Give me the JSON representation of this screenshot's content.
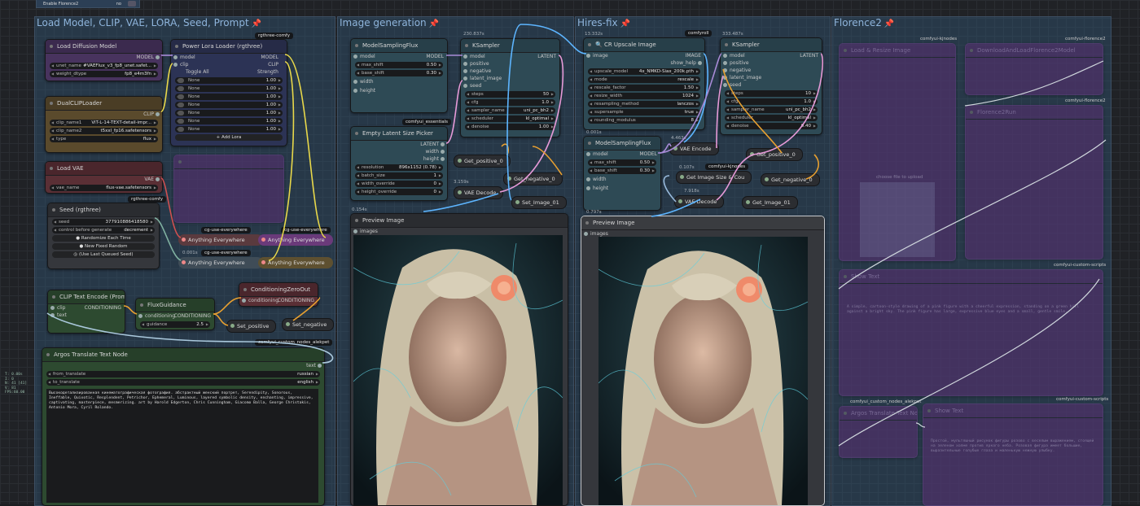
{
  "top_node": {
    "label": "Enable Florence2",
    "value": "no"
  },
  "groups": [
    {
      "title": "Load Model, CLIP, VAE, LORA, Seed, Prompt"
    },
    {
      "title": "Image generation"
    },
    {
      "title": "Hires-fix"
    },
    {
      "title": "Florence2"
    }
  ],
  "pin_icon": "📌",
  "badges": {
    "rgthree1": "rgthree-comfy",
    "rgthree2": "rgthree-comfy",
    "essentials": "comfyui_essentials",
    "comfyroll": "comfyroll",
    "kjnodes": "comfyui-kjnodes",
    "argos": "comfyui_custom_nodes_alekpet",
    "cg1": "cg-use-everywhere",
    "cg2": "cg-use-everywhere",
    "cg3": "cg-use-everywhere"
  },
  "timings": {
    "t1": "230.837s",
    "t2": "13.332s",
    "t3": "333.487s",
    "t4": "0.001s",
    "t5": "4.463s",
    "t6": "0.107s",
    "t7": "7.918s",
    "t8": "0.154s",
    "t9": "0.001s",
    "t10": "0.797s",
    "t11": "3.159s"
  },
  "load_diffusion": {
    "title": "Load Diffusion Model",
    "out": "MODEL",
    "unet_name": "unet_name",
    "unet_val": "#VAEFlux_v3_fp8_unet.safet...",
    "dtype": "weight_dtype",
    "dtype_val": "fp8_e4m3fn"
  },
  "lora": {
    "title": "Power Lora Loader (rgthree)",
    "in_model": "model",
    "in_clip": "clip",
    "out_model": "MODEL",
    "out_clip": "CLIP",
    "toggle": "Toggle All",
    "strength": "Strength",
    "rows": [
      {
        "n": "None",
        "v": "1.00"
      },
      {
        "n": "None",
        "v": "1.00"
      },
      {
        "n": "None",
        "v": "1.00"
      },
      {
        "n": "None",
        "v": "1.00"
      },
      {
        "n": "None",
        "v": "1.00"
      },
      {
        "n": "None",
        "v": "1.00"
      },
      {
        "n": "None",
        "v": "1.00"
      }
    ],
    "add": "+ Add Lora"
  },
  "dualclip": {
    "title": "DualCLIPLoader",
    "out": "CLIP",
    "c1": "clip_name1",
    "c1v": "ViT-L-14-TEXT-detail-impr...",
    "c2": "clip_name2",
    "c2v": "t5xxl_fp16.safetensors",
    "t": "type",
    "tv": "flux"
  },
  "vae": {
    "title": "Load VAE",
    "out": "VAE",
    "n": "vae_name",
    "v": "flux-vae.safetensors"
  },
  "seed": {
    "title": "Seed (rgthree)",
    "seed": "seed",
    "seed_val": "377910886418580",
    "cbg": "control before generate",
    "cbg_val": "decrement",
    "b1": "Randomize Each Time",
    "b2": "New Fixed Random",
    "b3": "(Use Last Queued Seed)"
  },
  "anything": [
    "Anything Everywhere",
    "Anything Everywhere",
    "Anything Everywhere",
    "Anything Everywhere",
    "Anything Everywhere"
  ],
  "clip_encode": {
    "title": "CLIP Text Encode (Prompt)",
    "clip": "clip",
    "text": "text",
    "out": "CONDITIONING"
  },
  "flux_guidance": {
    "title": "FluxGuidance",
    "in": "conditioning",
    "out": "CONDITIONING",
    "g": "guidance",
    "gv": "2.5"
  },
  "cond_zero": {
    "title": "ConditioningZeroOut",
    "in": "conditioning",
    "out": "CONDITIONING"
  },
  "set_positive": "Set_positive",
  "set_negative": "Set_negative",
  "argos": {
    "title": "Argos Translate Text Node",
    "out": "text",
    "from": "from_translate",
    "from_v": "russian",
    "to": "to_translate",
    "to_v": "english",
    "text": "Высокодетализированная кинематографическая фотография. абстрактный женский портрет, Serendipity, Sonorous, Ineffable, Quixotic, Resplendent, Petrichor, Ephemeral, Luminous, layered symbolic density, enchanting, impressive, captivating, masterpiece, mesmerizing. art by Harold Edgerton, Chris Cunningham, Giacomo Balla, George Christakis, Antonio Mora, Cyril Rolando."
  },
  "msf1": {
    "title": "ModelSamplingFlux",
    "in": "model",
    "out": "MODEL",
    "ms": "max_shift",
    "msv": "0.50",
    "bs": "base_shift",
    "bsv": "0.30",
    "w": "width",
    "h": "height"
  },
  "ksampler1": {
    "title": "KSampler",
    "out": "LATENT",
    "ins": [
      "model",
      "positive",
      "negative",
      "latent_image",
      "seed"
    ],
    "w": [
      {
        "k": "steps",
        "v": "50"
      },
      {
        "k": "cfg",
        "v": "1.0"
      },
      {
        "k": "sampler_name",
        "v": "uni_pc_bh2"
      },
      {
        "k": "scheduler",
        "v": "kl_optimal"
      },
      {
        "k": "denoise",
        "v": "1.00"
      }
    ]
  },
  "latent_picker": {
    "title": "Empty Latent Size Picker",
    "outs": [
      "LATENT",
      "width",
      "height"
    ],
    "w": [
      {
        "k": "resolution",
        "v": "896x1152 (0.78)"
      },
      {
        "k": "batch_size",
        "v": "1"
      },
      {
        "k": "width_override",
        "v": "0"
      },
      {
        "k": "height_override",
        "v": "0"
      }
    ]
  },
  "get_pos1": "Get_positive_0",
  "get_neg1": "Get_negative_0",
  "vae_decode1": "VAE Decode",
  "set_image": "Set_Image_01",
  "preview1": {
    "title": "Preview Image",
    "in": "images"
  },
  "upscale": {
    "title": "CR Upscale Image",
    "in": "image",
    "out1": "IMAGE",
    "out2": "show_help",
    "w": [
      {
        "k": "upscale_model",
        "v": "4x_NMKD-Siax_200k.pth"
      },
      {
        "k": "mode",
        "v": "rescale"
      },
      {
        "k": "rescale_factor",
        "v": "1.50"
      },
      {
        "k": "resize_width",
        "v": "1024"
      },
      {
        "k": "resampling_method",
        "v": "lanczos"
      },
      {
        "k": "supersample",
        "v": "true"
      },
      {
        "k": "rounding_modulus",
        "v": "8"
      }
    ]
  },
  "ksampler2": {
    "title": "KSampler",
    "out": "LATENT",
    "ins": [
      "model",
      "positive",
      "negative",
      "latent_image",
      "seed"
    ],
    "w": [
      {
        "k": "steps",
        "v": "10"
      },
      {
        "k": "cfg",
        "v": "1.0"
      },
      {
        "k": "sampler_name",
        "v": "uni_pc_bh2"
      },
      {
        "k": "scheduler",
        "v": "kl_optimal"
      },
      {
        "k": "denoise",
        "v": "0.40"
      }
    ]
  },
  "msf2": {
    "title": "ModelSamplingFlux",
    "in": "model",
    "out": "MODEL",
    "ms": "max_shift",
    "msv": "0.50",
    "bs": "base_shift",
    "bsv": "0.30",
    "w": "width",
    "h": "height"
  },
  "vae_encode": "VAE Encode",
  "get_image_size": "Get Image Size & Cou",
  "vae_decode2": "VAE Decode",
  "get_pos2": "Get_positive_0",
  "get_neg2": "Get_negative_0",
  "get_image": "Get_Image_01",
  "preview2": {
    "title": "Preview Image",
    "in": "images"
  },
  "florence": {
    "g1": "comfyui-kjnodes",
    "g2": "comfyui-florence2",
    "g3": "comfyui-florence2",
    "g4": "comfyui-custom-scripts",
    "g5": "comfyui_custom_nodes_alekpet",
    "g6": "comfyui-custom-scripts",
    "n1": "Load & Resize Image",
    "n2": "DownloadAndLoadFlorence2Model",
    "n3": "Florence2Run",
    "n4": "Show Text",
    "n5": "Argos Translate Text Node",
    "n6": "Show Text",
    "upload": "choose file to upload",
    "sample1": "A simple, cartoon-style drawing of a pink figure with a cheerful expression, standing on a green hill against a bright sky. The pink figure has large, expressive blue eyes and a small, gentle smile.",
    "sample2": "Простой, мультяшный рисунок фигуры розово с веселым выражением, стоящей на зеленом холме против яркого неба. Розовая фигура имеет большие, выразительные голубые глаза и маленькую нежную улыбку."
  },
  "stats": [
    "T: 0.00s",
    "I: 0",
    "N: 41 [41]",
    "V: 81",
    "FPS:60.00"
  ]
}
